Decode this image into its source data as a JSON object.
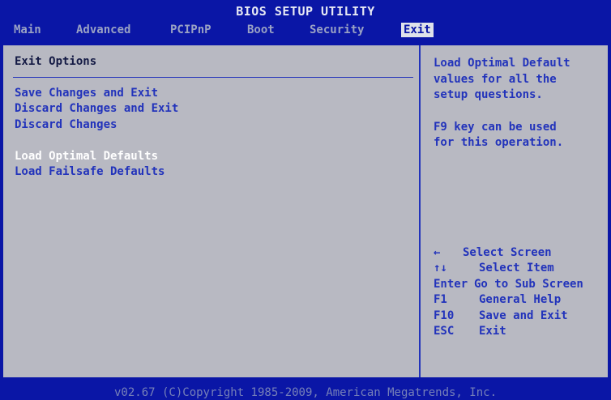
{
  "title": "BIOS SETUP UTILITY",
  "tabs": [
    {
      "label": "Main",
      "active": false
    },
    {
      "label": "Advanced",
      "active": false
    },
    {
      "label": "PCIPnP",
      "active": false
    },
    {
      "label": "Boot",
      "active": false
    },
    {
      "label": "Security",
      "active": false
    },
    {
      "label": "Exit",
      "active": true
    }
  ],
  "left_panel": {
    "section_title": "Exit Options",
    "items": [
      {
        "label": "Save Changes and Exit",
        "selected": false
      },
      {
        "label": "Discard Changes and Exit",
        "selected": false
      },
      {
        "label": "Discard Changes",
        "selected": false
      },
      {
        "label": "Load Optimal Defaults",
        "selected": true
      },
      {
        "label": "Load Failsafe Defaults",
        "selected": false
      }
    ]
  },
  "help": {
    "lines": [
      "Load Optimal Default",
      "values for all the",
      "setup questions.",
      "F9 key can be used",
      "for this operation."
    ]
  },
  "keys": [
    {
      "key": "←",
      "desc": "Select Screen"
    },
    {
      "key": "↑↓",
      "desc": "Select Item"
    },
    {
      "key": "Enter",
      "desc": "Go to Sub Screen"
    },
    {
      "key": "F1",
      "desc": "General Help"
    },
    {
      "key": "F10",
      "desc": "Save and Exit"
    },
    {
      "key": "ESC",
      "desc": "Exit"
    }
  ],
  "footer": "v02.67 (C)Copyright 1985-2009, American Megatrends, Inc.",
  "colors": {
    "background": "#0a16a6",
    "panel": "#b8b9c2",
    "item_text": "#2233bb",
    "selected_text": "#ffffff",
    "active_tab": "#dfe2ea"
  }
}
